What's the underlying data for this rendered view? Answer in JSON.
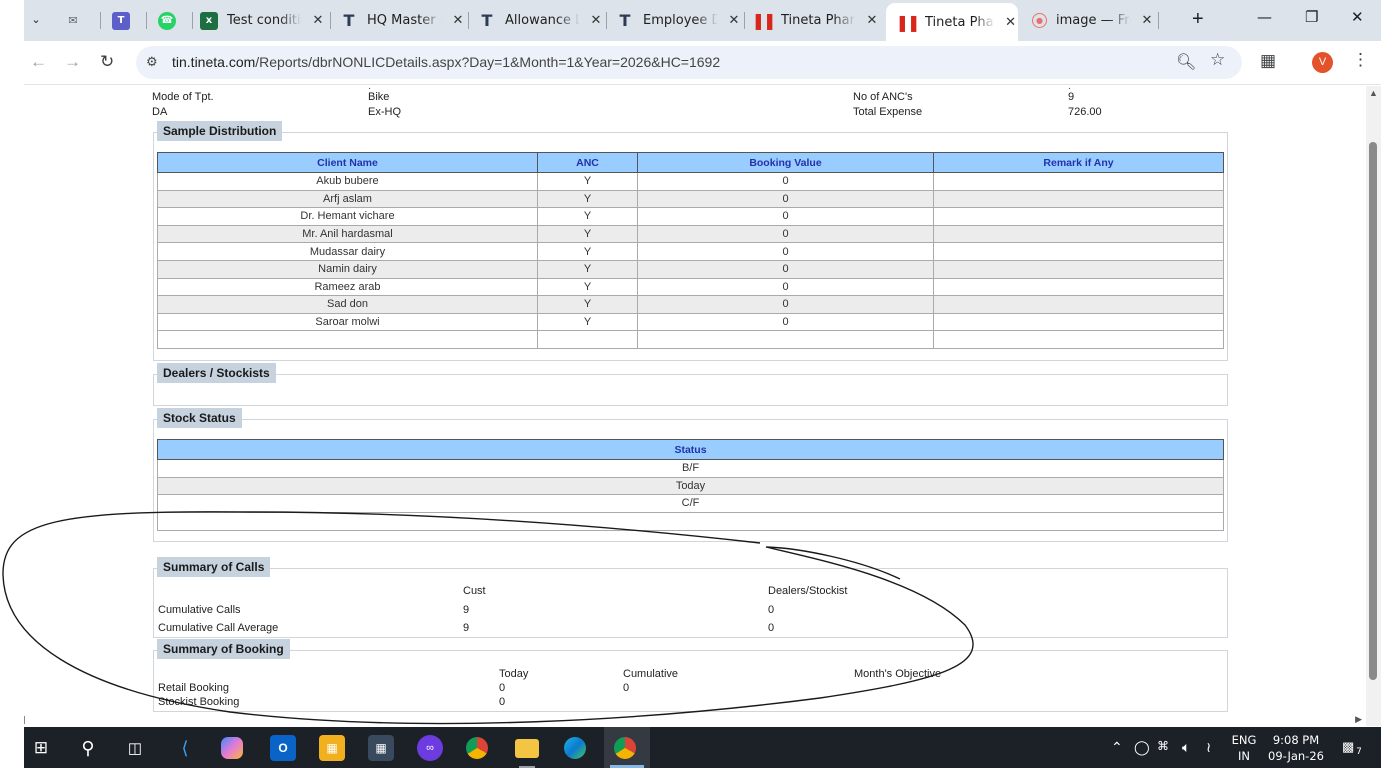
{
  "browser": {
    "tabs": [
      {
        "label": "",
        "icon": "mail-outline-icon",
        "icon_color": "#5f6368"
      },
      {
        "label": "",
        "icon": "teams-icon",
        "icon_color": "#5b5fc7"
      },
      {
        "label": "",
        "icon": "whatsapp-icon",
        "icon_color": "#25d366"
      },
      {
        "label": "Test conditio",
        "icon": "excel-icon",
        "icon_color": "#1d6f42"
      },
      {
        "label": "HQ Master |",
        "icon": "tineta-t-icon",
        "icon_color": "#2d3b55"
      },
      {
        "label": "Allowance Li",
        "icon": "tineta-t-icon",
        "icon_color": "#2d3b55"
      },
      {
        "label": "Employee De",
        "icon": "tineta-t-icon",
        "icon_color": "#2d3b55"
      },
      {
        "label": "Tineta Pharm",
        "icon": "tineta-bars-icon",
        "icon_color": "#d9261c"
      },
      {
        "label": "Tineta Pharm",
        "icon": "tineta-bars-icon",
        "icon_color": "#d9261c",
        "active": true
      },
      {
        "label": "image — Fre",
        "icon": "image-circle-icon",
        "icon_color": "#e8716a"
      }
    ],
    "url_host": "tin.tineta.com",
    "url_path": "/Reports/dbrNONLICDetails.aspx?Day=1&Month=1&Year=2026&HC=1692",
    "profile_initial": "V"
  },
  "report": {
    "info_rows": [
      {
        "label": "Mode of Tpt.",
        "value": "Bike",
        "label2": "No of ANC's",
        "value2": "9"
      },
      {
        "label": "DA",
        "value": "Ex-HQ",
        "label2": "Total Expense",
        "value2": "726.00"
      }
    ],
    "sample_distribution": {
      "legend": "Sample Distribution",
      "headers": [
        "Client Name",
        "ANC",
        "Booking Value",
        "Remark if Any"
      ],
      "rows": [
        [
          "Akub bubere",
          "Y",
          "0",
          ""
        ],
        [
          "Arfj aslam",
          "Y",
          "0",
          ""
        ],
        [
          "Dr. Hemant vichare",
          "Y",
          "0",
          ""
        ],
        [
          "Mr. Anil hardasmal",
          "Y",
          "0",
          ""
        ],
        [
          "Mudassar dairy",
          "Y",
          "0",
          ""
        ],
        [
          "Namin dairy",
          "Y",
          "0",
          ""
        ],
        [
          "Rameez arab",
          "Y",
          "0",
          ""
        ],
        [
          "Sad don",
          "Y",
          "0",
          ""
        ],
        [
          "Saroar molwi",
          "Y",
          "0",
          ""
        ]
      ]
    },
    "dealers": {
      "legend": "Dealers / Stockists"
    },
    "stock_status": {
      "legend": "Stock Status",
      "header": "Status",
      "rows": [
        "B/F",
        "Today",
        "C/F"
      ]
    },
    "summary_calls": {
      "legend": "Summary of Calls",
      "col1": "Cust",
      "col2": "Dealers/Stockist",
      "rows": [
        {
          "label": "Cumulative Calls",
          "cust": "9",
          "dealers": "0"
        },
        {
          "label": "Cumulative Call Average",
          "cust": "9",
          "dealers": "0"
        }
      ]
    },
    "summary_booking": {
      "legend": "Summary of Booking",
      "col1": "Today",
      "col2": "Cumulative",
      "col3": "Month's Objective",
      "rows": [
        {
          "label": "Retail Booking",
          "today": "0",
          "cumulative": "0"
        },
        {
          "label": "Stockist Booking",
          "today": "0",
          "cumulative": ""
        }
      ]
    }
  },
  "taskbar": {
    "language": "ENG",
    "region": "IN",
    "time": "9:08 PM",
    "date": "09-Jan-26",
    "notification_count": "7"
  },
  "colors": {
    "tab_strip": "#dde3ea",
    "table_header": "#99ccff",
    "legend_bg": "#c6d2de",
    "annotation_stroke": "#1a1a1a"
  }
}
